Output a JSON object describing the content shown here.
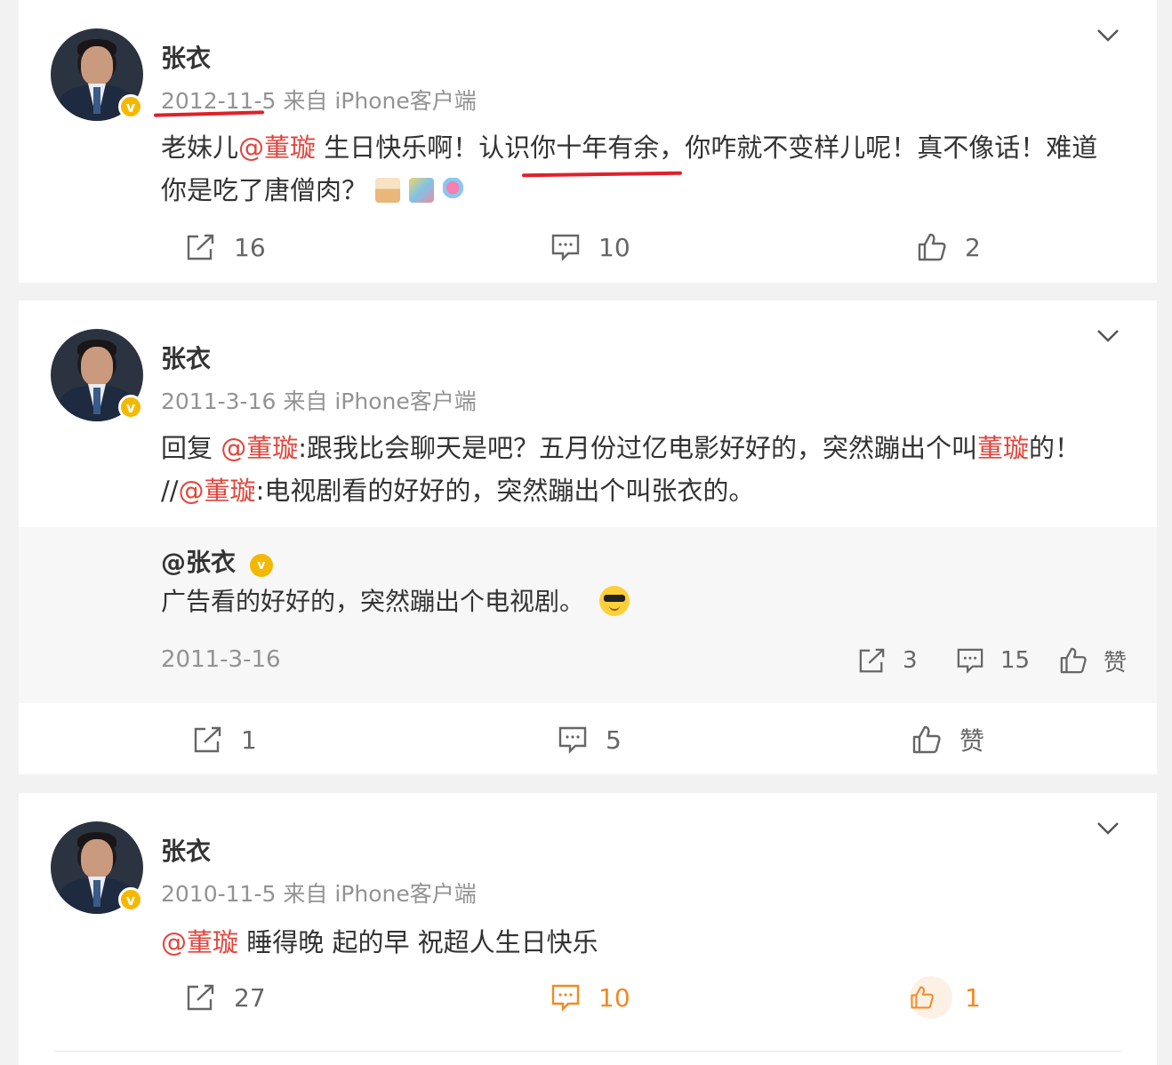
{
  "posts": [
    {
      "author": "张衣",
      "date": "2012-11-5",
      "source": "来自 iPhone客户端",
      "text_prefix": "老妹儿",
      "mention": "@董璇",
      "text_suffix": " 生日快乐啊！认识你十年有余，你咋就不变样儿呢！真不像话！难道你是吃了唐僧肉？",
      "emojis": [
        "cake-emoji",
        "party-emoji",
        "lollipop-emoji"
      ],
      "reposts": "16",
      "comments": "10",
      "likes": "2"
    },
    {
      "author": "张衣",
      "date": "2011-3-16",
      "source": "来自 iPhone客户端",
      "reply_prefix": "回复 ",
      "mention1": "@董璇",
      "reply_text1": ":跟我比会聊天是吧？五月份过亿电影好好的，突然蹦出个叫",
      "mention2": "董璇",
      "reply_text2": "的！",
      "line2_prefix": "//",
      "mention3": "@董璇",
      "reply_text3": ":电视剧看的好好的，突然蹦出个叫张衣的。",
      "quoted": {
        "author": "@张衣",
        "text": "广告看的好好的，突然蹦出个电视剧。",
        "date": "2011-3-16",
        "reposts": "3",
        "comments": "15",
        "likes": "赞"
      },
      "reposts": "1",
      "comments": "5",
      "likes": "赞"
    },
    {
      "author": "张衣",
      "date": "2010-11-5",
      "source": "来自 iPhone客户端",
      "mention": "@董璇",
      "text_suffix": " 睡得晚 起的早 祝超人生日快乐",
      "reposts": "27",
      "comments": "10",
      "likes": "1"
    }
  ],
  "colors": {
    "mention": "#e0463d",
    "active_orange": "#f08a24",
    "annotation_red": "#e0202a",
    "verified_gold": "#f5b800"
  }
}
